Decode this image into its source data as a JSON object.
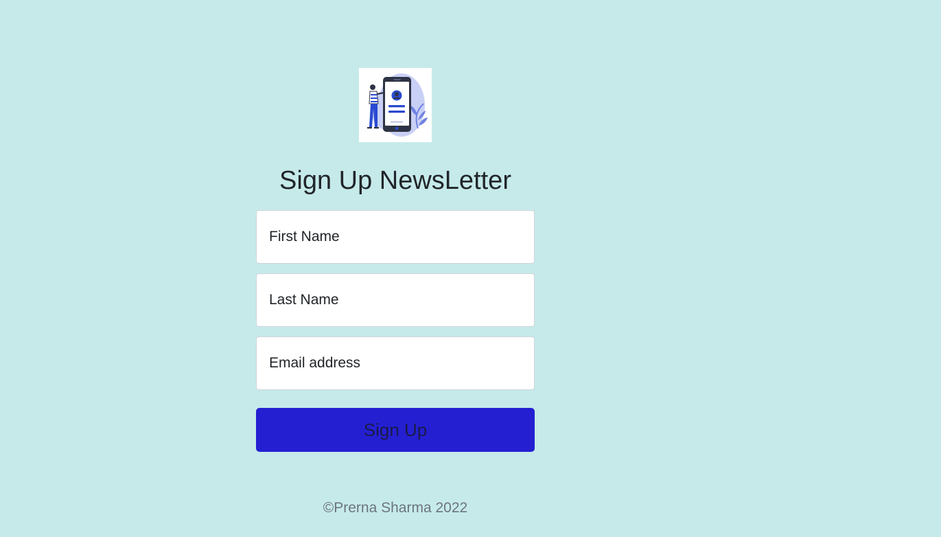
{
  "signup": {
    "heading": "Sign Up NewsLetter",
    "first_name_placeholder": "First Name",
    "last_name_placeholder": "Last Name",
    "email_placeholder": "Email address",
    "button_label": "Sign Up"
  },
  "footer": {
    "copyright": "©Prerna Sharma 2022"
  },
  "colors": {
    "background": "#c6eaea",
    "button": "#2420d2",
    "illustration_accent": "#2a4ad0"
  }
}
